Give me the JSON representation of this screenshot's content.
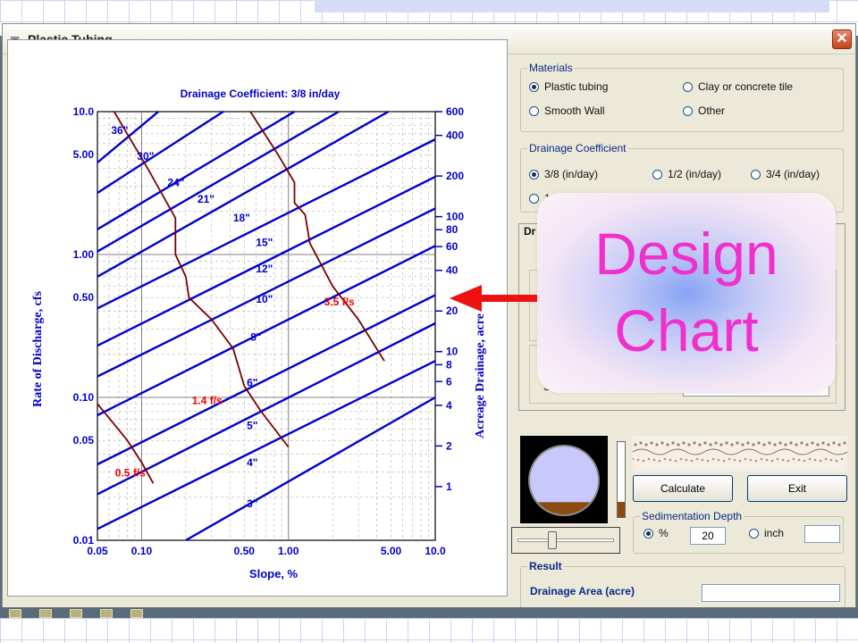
{
  "window": {
    "title": "Plastic Tubing",
    "title_icon": "window-icon",
    "close_icon": "close-icon"
  },
  "chart": {
    "title": "Drainage Coefficient: 3/8 in/day",
    "x_label": "Slope, %",
    "y_left_label": "Rate of Discharge, cfs",
    "y_right_label": "Acreage Drainage, acre",
    "x_ticks": [
      "0.05",
      "0.10",
      "0.50",
      "1.00",
      "5.00",
      "10.0"
    ],
    "y_ticks": [
      "0.01",
      "0.05",
      "0.10",
      "0.50",
      "1.00",
      "5.00",
      "10.0"
    ],
    "right_ticks": [
      "1",
      "2",
      "4",
      "6",
      "8",
      "10",
      "20",
      "40",
      "60",
      "80",
      "100",
      "200",
      "400",
      "600"
    ],
    "pipe_labels": [
      "36\"",
      "30\"",
      "24\"",
      "21\"",
      "18\"",
      "15\"",
      "12\"",
      "10\"",
      "8\"",
      "6\"",
      "5\"",
      "4\"",
      "3\""
    ],
    "velocity_labels": [
      "0.5 f/s",
      "1.4 f/s",
      "3.5 f/s"
    ]
  },
  "chart_data": {
    "type": "line",
    "title": "Drainage Coefficient: 3/8 in/day",
    "xlabel": "Slope, %",
    "ylabel": "Rate of Discharge, cfs",
    "y2label": "Acreage Drainage, acre",
    "x_scale": "log",
    "y_scale": "log",
    "xlim": [
      0.05,
      10.0
    ],
    "ylim": [
      0.01,
      10.0
    ],
    "y2lim": [
      0.4,
      600
    ],
    "grid": true,
    "series": [
      {
        "name": "3\"",
        "x": [
          0.2,
          10.0
        ],
        "y": [
          0.01,
          0.1
        ]
      },
      {
        "name": "4\"",
        "x": [
          0.05,
          10.0
        ],
        "y": [
          0.012,
          0.18
        ]
      },
      {
        "name": "5\"",
        "x": [
          0.05,
          10.0
        ],
        "y": [
          0.021,
          0.33
        ]
      },
      {
        "name": "6\"",
        "x": [
          0.05,
          10.0
        ],
        "y": [
          0.034,
          0.52
        ]
      },
      {
        "name": "8\"",
        "x": [
          0.05,
          10.0
        ],
        "y": [
          0.075,
          1.15
        ]
      },
      {
        "name": "10\"",
        "x": [
          0.05,
          10.0
        ],
        "y": [
          0.14,
          2.1
        ]
      },
      {
        "name": "12\"",
        "x": [
          0.05,
          10.0
        ],
        "y": [
          0.23,
          3.5
        ]
      },
      {
        "name": "15\"",
        "x": [
          0.05,
          10.0
        ],
        "y": [
          0.42,
          6.4
        ]
      },
      {
        "name": "18\"",
        "x": [
          0.05,
          4.8
        ],
        "y": [
          0.7,
          10.0
        ]
      },
      {
        "name": "21\"",
        "x": [
          0.05,
          2.2
        ],
        "y": [
          1.05,
          10.0
        ]
      },
      {
        "name": "24\"",
        "x": [
          0.05,
          1.1
        ],
        "y": [
          1.5,
          10.0
        ]
      },
      {
        "name": "30\"",
        "x": [
          0.05,
          0.36
        ],
        "y": [
          2.7,
          10.0
        ]
      },
      {
        "name": "36\"",
        "x": [
          0.05,
          0.13
        ],
        "y": [
          4.4,
          10.0
        ]
      },
      {
        "name": "0.5 f/s",
        "x": [
          0.05,
          0.065,
          0.08,
          0.1,
          0.12
        ],
        "y": [
          0.09,
          0.065,
          0.05,
          0.035,
          0.025
        ]
      },
      {
        "name": "1.4 f/s",
        "x": [
          0.065,
          0.11,
          0.17,
          0.17,
          0.2,
          0.21,
          0.3,
          0.42,
          0.5,
          0.65,
          1.0
        ],
        "y": [
          10.0,
          4.0,
          1.8,
          1.0,
          0.7,
          0.5,
          0.35,
          0.22,
          0.12,
          0.08,
          0.045
        ]
      },
      {
        "name": "3.5 f/s",
        "x": [
          0.55,
          0.85,
          1.1,
          1.1,
          1.3,
          1.4,
          2.0,
          3.0,
          4.5
        ],
        "y": [
          10.0,
          5.0,
          3.2,
          2.3,
          1.9,
          1.2,
          0.6,
          0.35,
          0.18
        ]
      }
    ]
  },
  "materials": {
    "legend": "Materials",
    "options": [
      {
        "label": "Plastic tubing",
        "selected": true
      },
      {
        "label": "Clay or concrete tile",
        "selected": false
      },
      {
        "label": "Smooth Wall",
        "selected": false
      },
      {
        "label": "Other",
        "selected": false
      }
    ]
  },
  "drainage_coefficient": {
    "legend": "Drainage Coefficient",
    "options": [
      {
        "label": "3/8 (in/day)",
        "selected": true
      },
      {
        "label": "1/2 (in/day)",
        "selected": false
      },
      {
        "label": "3/4 (in/day)",
        "selected": false
      },
      {
        "label": "1 (",
        "selected": false
      }
    ]
  },
  "tab": {
    "label": "Dr",
    "s_label": "S"
  },
  "buttons": {
    "calculate": "Calculate",
    "exit": "Exit"
  },
  "sedimentation": {
    "legend": "Sedimentation Depth",
    "percent_label": "%",
    "percent_selected": true,
    "percent_value": "20",
    "inch_label": "inch",
    "inch_value": ""
  },
  "result": {
    "legend": "Result",
    "drainage_area_label": "Drainage Area (acre)",
    "drainage_area_value": ""
  },
  "overlay": {
    "line1": "Design",
    "line2": "Chart"
  },
  "indicators": {
    "pipe_fill_fraction": 0.18,
    "level_fill_fraction": 0.2,
    "slider_fraction": 0.35
  },
  "colors": {
    "pipe_line": "#0000cc",
    "velocity_line": "#7a0000",
    "velocity_label": "#ee0000",
    "overlay_text": "#f030cc",
    "arrow": "#ee1111",
    "sediment": "#8a4a10",
    "pipe_interior": "#c8c8ff"
  }
}
